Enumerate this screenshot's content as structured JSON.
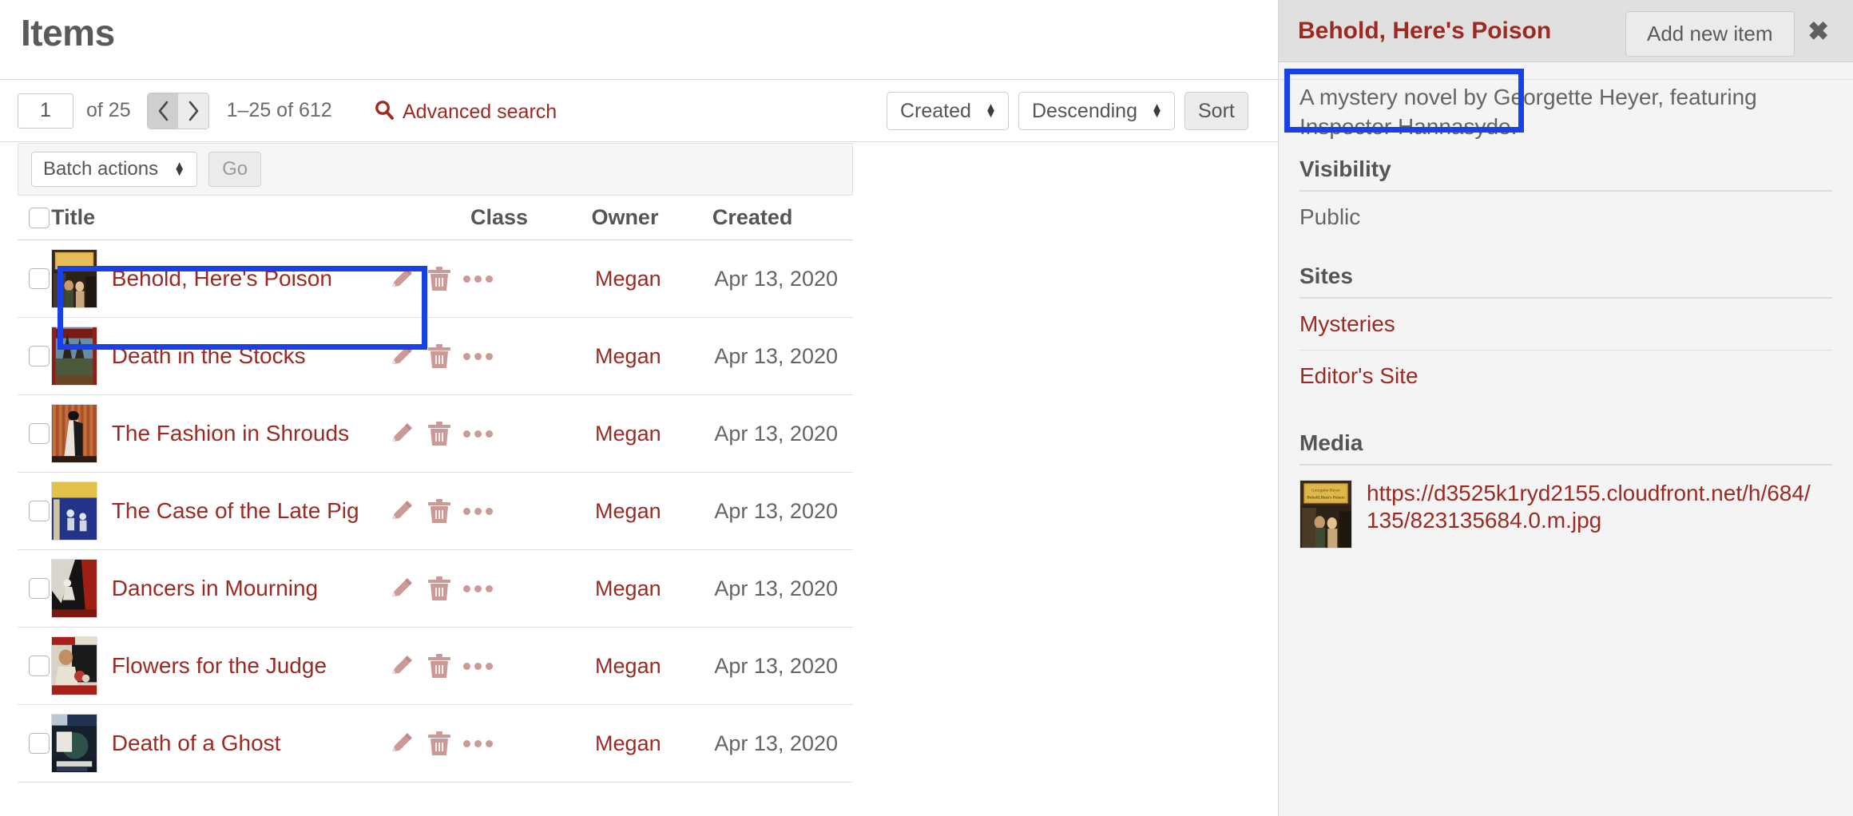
{
  "header": {
    "title": "Items",
    "add_new_label": "Add new item"
  },
  "toolbar": {
    "page_value": "1",
    "page_total_label": "of 25",
    "prev_icon": "chevron-left-icon",
    "next_icon": "chevron-right-icon",
    "range_label": "1–25 of 612",
    "advanced_search_label": "Advanced search",
    "search_icon": "search-icon",
    "sort_by_value": "Created",
    "sort_dir_value": "Descending",
    "sort_button_label": "Sort"
  },
  "batch": {
    "select_value": "Batch actions",
    "go_label": "Go"
  },
  "table": {
    "columns": [
      "Title",
      "Class",
      "Owner",
      "Created"
    ],
    "row_actions": [
      "edit-pencil-icon",
      "delete-trash-icon",
      "more-ellipsis-icon"
    ],
    "rows": [
      {
        "title": "Behold, Here's Poison",
        "class": "",
        "owner": "Megan",
        "created": "Apr 13, 2020"
      },
      {
        "title": "Death in the Stocks",
        "class": "",
        "owner": "Megan",
        "created": "Apr 13, 2020"
      },
      {
        "title": "The Fashion in Shrouds",
        "class": "",
        "owner": "Megan",
        "created": "Apr 13, 2020"
      },
      {
        "title": "The Case of the Late Pig",
        "class": "",
        "owner": "Megan",
        "created": "Apr 13, 2020"
      },
      {
        "title": "Dancers in Mourning",
        "class": "",
        "owner": "Megan",
        "created": "Apr 13, 2020"
      },
      {
        "title": "Flowers for the Judge",
        "class": "",
        "owner": "Megan",
        "created": "Apr 13, 2020"
      },
      {
        "title": "Death of a Ghost",
        "class": "",
        "owner": "Megan",
        "created": "Apr 13, 2020"
      }
    ]
  },
  "sidebar": {
    "title": "Behold, Here's Poison",
    "close_icon": "close-icon",
    "description": "A mystery novel by Georgette Heyer, featuring Inspector Hannasyde.",
    "visibility_heading": "Visibility",
    "visibility_value": "Public",
    "sites_heading": "Sites",
    "sites": [
      "Mysteries",
      "Editor's Site"
    ],
    "media_heading": "Media",
    "media_url": "https://d3525k1ryd2155.cloudfront.net/h/684/135/823135684.0.m.jpg"
  },
  "colors": {
    "link_red": "#9c2a22",
    "text_gray": "#656565",
    "highlight_blue": "#1a41e8",
    "panel_bg": "#f4f4f4",
    "panel_header_bg": "#e0e0e0"
  }
}
